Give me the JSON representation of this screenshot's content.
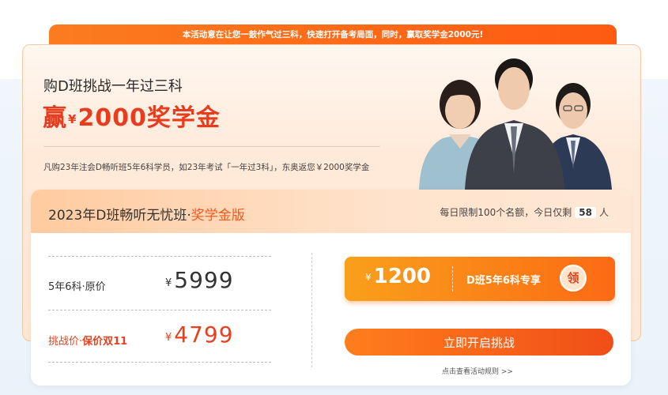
{
  "banner": {
    "text_part1": "本活动意在让您一鼓作气过三科，快速打开备考局面，",
    "text_part2": "同时，赢取奖学金2000元!"
  },
  "hero": {
    "headline_small": "购D班挑战一年过三科",
    "headline_big_prefix": "赢",
    "headline_big_yen": "¥",
    "headline_big_suffix": "2000奖学金",
    "description": "凡购23年注会D畅听班5年6科学员，如23年考试「一年过3科」，东奥返您￥2000奖学金"
  },
  "plan": {
    "title_main": "2023年D班畅听无忧班·",
    "title_accent": "奖学金版",
    "quota_prefix": "每日限制100个名额，今日仅剩",
    "quota_count": "58",
    "quota_suffix": "人"
  },
  "prices": {
    "original_label": "5年6科·原价",
    "original_yen": "¥",
    "original_value": "5999",
    "challenge_label_prefix": "挑战价·",
    "challenge_label_bold": "保价双11",
    "challenge_yen": "¥",
    "challenge_value": "4799"
  },
  "coupon": {
    "yen": "¥",
    "amount": "1200",
    "description": "D班5年6科专享",
    "claim_label": "领"
  },
  "cta": {
    "label": "立即开启挑战"
  },
  "rules_link": "点击查看活动规则 >>",
  "colors": {
    "accent": "#f05a1f",
    "price_red": "#e8401f",
    "button_orange": "#fc6a14"
  }
}
